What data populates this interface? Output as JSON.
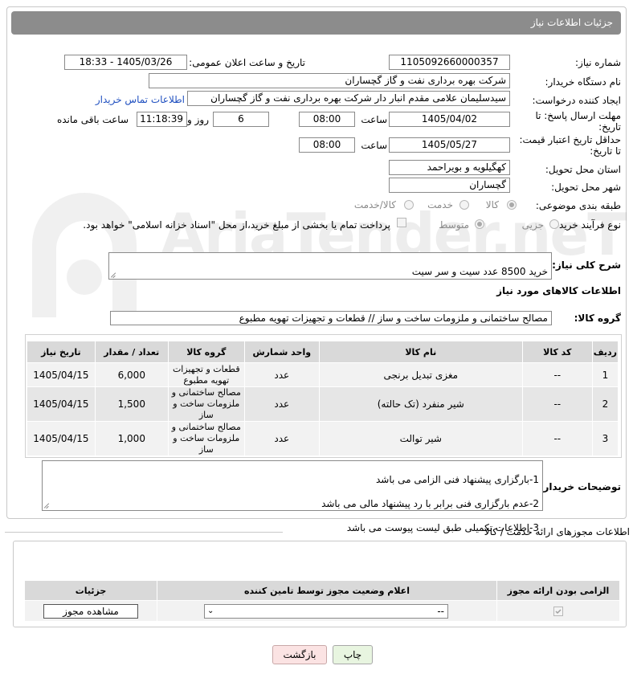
{
  "header": {
    "title": "جزئیات اطلاعات نیاز"
  },
  "watermark": "AriaTender.neT",
  "fields": {
    "need_number_label": "شماره نیاز:",
    "need_number": "1105092660000357",
    "announce_label": "تاریخ و ساعت اعلان عمومی:",
    "announce_value": "1405/03/26 - 18:33",
    "buyer_org_label": "نام دستگاه خریدار:",
    "buyer_org": "شرکت بهره برداری نفت و گاز گچساران",
    "requester_label": "ایجاد کننده درخواست:",
    "requester": "سیدسلیمان علامی مقدم انبار دار شرکت بهره برداری نفت و گاز گچساران",
    "contact_link": "اطلاعات تماس خریدار",
    "reply_deadline_label_1": "مهلت ارسال پاسخ: تا",
    "reply_deadline_label_2": "تاریخ:",
    "reply_date": "1405/04/02",
    "time_label": "ساعت",
    "reply_time": "08:00",
    "days_value": "6",
    "days_label": "روز و",
    "remaining_time": "11:18:39",
    "remaining_label": "ساعت باقی مانده",
    "price_deadline_label_1": "حداقل تاریخ اعتبار قیمت:",
    "price_deadline_label_2": "تا تاریخ:",
    "price_date": "1405/05/27",
    "price_time": "08:00",
    "province_label": "استان محل تحویل:",
    "province": "کهگیلویه و بویراحمد",
    "city_label": "شهر محل تحویل:",
    "city": "گچساران",
    "category_label": "طبقه بندی موضوعی:",
    "category_options": [
      "کالا",
      "خدمت",
      "کالا/خدمت"
    ],
    "process_label": "نوع فرآیند خرید :",
    "process_options": [
      "جزیی",
      "متوسط"
    ],
    "payment_note": "پرداخت تمام یا بخشی از مبلغ خرید،از محل \"اسناد خزانه اسلامی\" خواهد بود."
  },
  "summary": {
    "label": "شرح کلی نیاز:",
    "value": "خرید 8500 عدد  سیت و سر سیت"
  },
  "goods_section_title": "اطلاعات کالاهای مورد نیاز",
  "goods_group": {
    "label": "گروه کالا:",
    "value": "مصالح ساختمانی و ملزومات ساخت و ساز //  قطعات و تجهیزات تهویه مطبوع"
  },
  "goods_table": {
    "headers": [
      "ردیف",
      "کد کالا",
      "نام کالا",
      "واحد شمارش",
      "گروه کالا",
      "تعداد / مقدار",
      "تاریخ نیاز"
    ],
    "rows": [
      {
        "idx": "1",
        "code": "--",
        "name": "مغزی تبدیل برنجی",
        "unit": "عدد",
        "group": "قطعات و تجهیزات تهویه مطبوع",
        "qty": "6,000",
        "date": "1405/04/15"
      },
      {
        "idx": "2",
        "code": "--",
        "name": "شیر منفرد (تک حالته)",
        "unit": "عدد",
        "group": "مصالح ساختمانی و ملزومات ساخت و ساز",
        "qty": "1,500",
        "date": "1405/04/15"
      },
      {
        "idx": "3",
        "code": "--",
        "name": "شیر توالت",
        "unit": "عدد",
        "group": "مصالح ساختمانی و ملزومات ساخت و ساز",
        "qty": "1,000",
        "date": "1405/04/15"
      }
    ]
  },
  "buyer_notes": {
    "label": "توضیحات خریدار:",
    "lines": [
      "1-بارگزاری پیشنهاد فنی الزامی می باشد",
      "2-عدم بارگزاری فنی برابر با رد پیشنهاد مالی می باشد",
      "3-اطلاعات تکمیلی طبق لیست پیوست می باشد"
    ]
  },
  "permits": {
    "title": "اطلاعات مجوزهای ارائه خدمت / کالا",
    "headers": [
      "الزامی بودن ارائه مجوز",
      "اعلام وضعیت مجوز توسط تامین کننده",
      "جزئیات"
    ],
    "select_value": "--",
    "view_button": "مشاهده مجوز"
  },
  "buttons": {
    "print": "چاپ",
    "back": "بازگشت"
  }
}
